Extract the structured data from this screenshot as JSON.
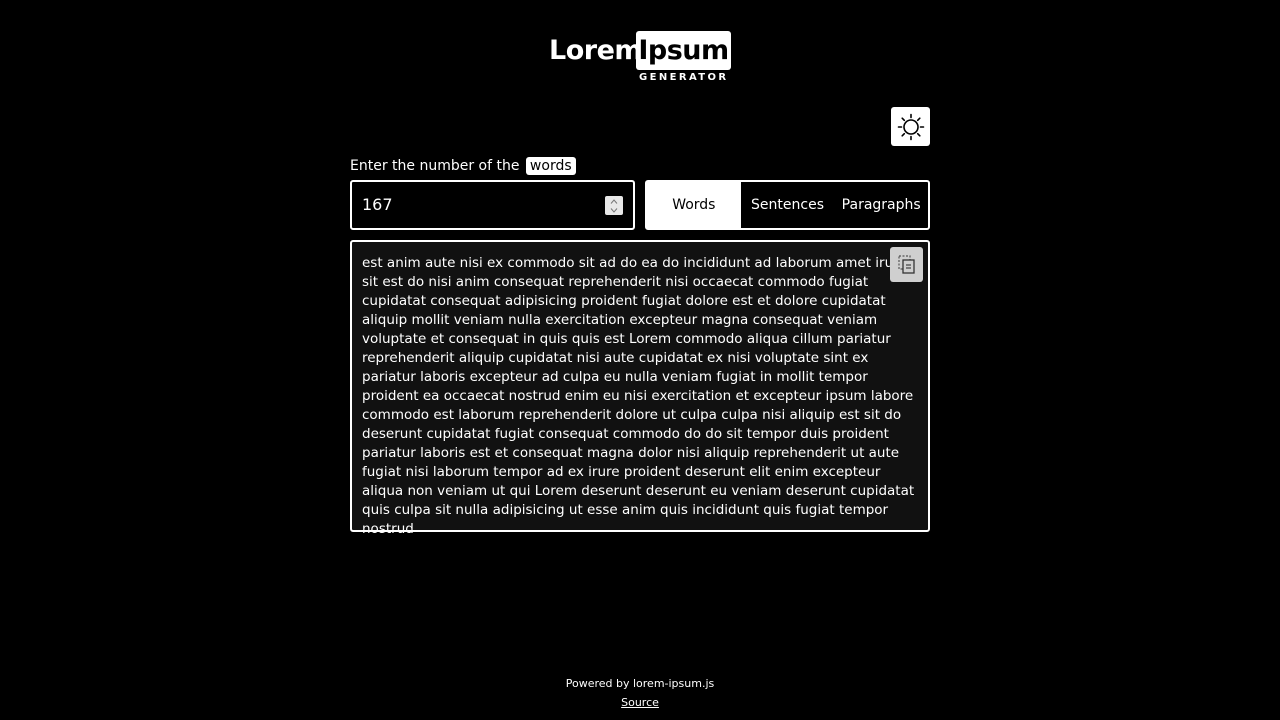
{
  "logo": {
    "word1": "Lorem",
    "word2": "Ipsum",
    "sub": "GENERATOR"
  },
  "theme_toggle": {
    "icon": "sun-icon"
  },
  "count_label": {
    "prefix": "Enter the number of the",
    "unit": "words"
  },
  "count_input": {
    "value": "167"
  },
  "units": {
    "options": [
      "Words",
      "Sentences",
      "Paragraphs"
    ],
    "selected": "Words"
  },
  "output": {
    "text": "est anim aute nisi ex commodo sit ad do ea do incididunt ad laborum amet irure sit est do nisi anim consequat reprehenderit nisi occaecat commodo fugiat cupidatat consequat adipisicing proident fugiat dolore est et dolore cupidatat aliquip mollit veniam nulla exercitation excepteur magna consequat veniam voluptate et consequat in quis quis est Lorem commodo aliqua cillum pariatur reprehenderit aliquip cupidatat nisi aute cupidatat ex nisi voluptate sint ex pariatur laboris excepteur ad culpa eu nulla veniam fugiat in mollit tempor proident ea occaecat nostrud enim eu nisi exercitation et excepteur ipsum labore commodo est laborum reprehenderit dolore ut culpa culpa nisi aliquip est sit do deserunt cupidatat fugiat consequat commodo do do sit tempor duis proident pariatur laboris est et consequat magna dolor nisi aliquip reprehenderit ut aute fugiat nisi laborum tempor ad ex irure proident deserunt elit enim excepteur aliqua non veniam ut qui Lorem deserunt deserunt eu veniam deserunt cupidatat quis culpa sit nulla adipisicing ut esse anim quis incididunt quis fugiat tempor nostrud",
    "copy_icon": "copy-icon"
  },
  "footer": {
    "powered": "Powered by lorem-ipsum.js",
    "source": "Source"
  },
  "colors": {
    "background": "#000000",
    "foreground": "#ffffff",
    "textarea_bg": "#111111"
  }
}
